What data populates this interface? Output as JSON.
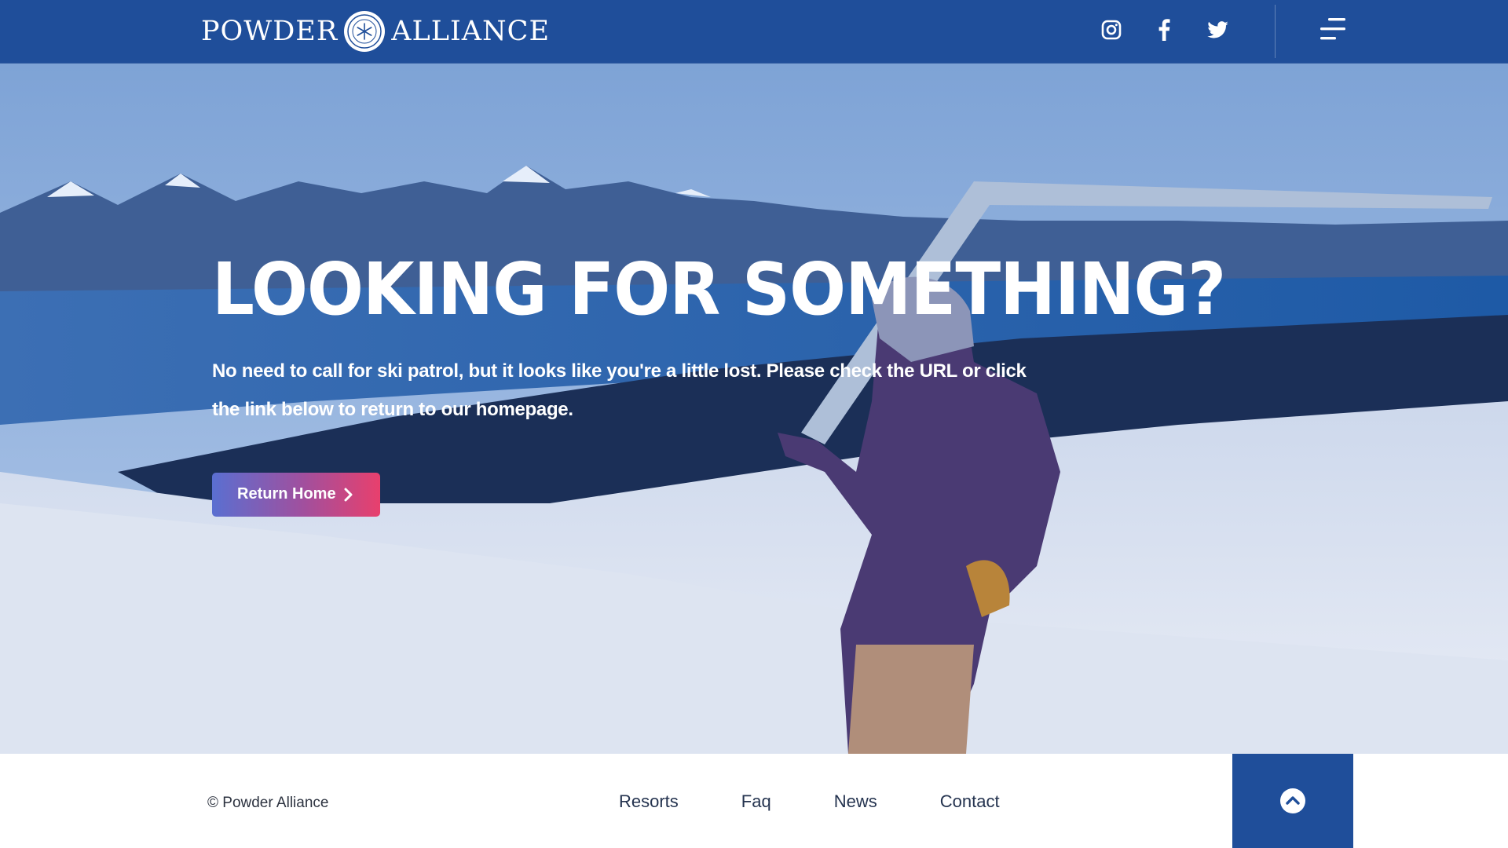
{
  "header": {
    "logo_left": "POWDER",
    "logo_right": "ALLIANCE",
    "social": [
      {
        "name": "instagram",
        "icon": "instagram-icon"
      },
      {
        "name": "facebook",
        "icon": "facebook-icon"
      },
      {
        "name": "twitter",
        "icon": "twitter-icon"
      }
    ],
    "menu_icon": "menu-icon"
  },
  "hero": {
    "title": "LOOKING FOR SOMETHING?",
    "text": "No need to call for ski patrol, but it looks like you're a little lost. Please check the URL or click the link below to return to our homepage.",
    "button_label": "Return Home",
    "button_icon": "chevron-right-icon"
  },
  "footer": {
    "copyright": "© Powder Alliance",
    "nav": [
      "Resorts",
      "Faq",
      "News",
      "Contact"
    ],
    "back_to_top_icon": "chevron-up-icon"
  },
  "colors": {
    "header_bg": "#1f4e9a",
    "footer_text": "#24334f",
    "button_gradient_start": "#5a6fd1",
    "button_gradient_end": "#e8406d"
  }
}
